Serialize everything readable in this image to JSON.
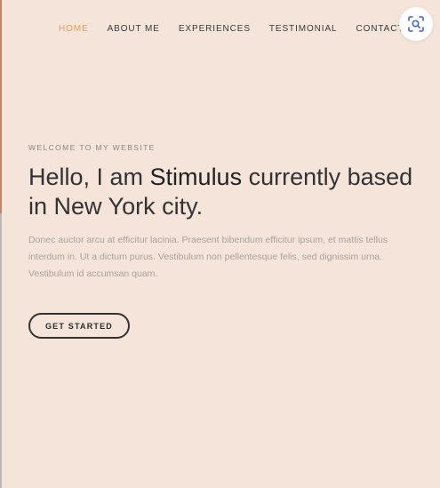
{
  "nav": {
    "items": [
      {
        "label": "HOME",
        "active": true
      },
      {
        "label": "ABOUT ME",
        "active": false
      },
      {
        "label": "EXPERIENCES",
        "active": false
      },
      {
        "label": "TESTIMONIAL",
        "active": false
      },
      {
        "label": "CONTACT",
        "active": false
      }
    ]
  },
  "hero": {
    "welcome": "WELCOME TO MY WEBSITE",
    "headline_prefix": "Hello, I am ",
    "headline_name": "Stimulus",
    "headline_suffix": " currently based in New York city.",
    "description": "Donec auctor arcu at efficitur lacinia. Praesent bibendum efficitur ipsum, et mattis tellus interdum in. Ut a dictum purus. Vestibulum non pellentesque felis, sed dignissim urna. Vestibulum id accumsan quam.",
    "cta_label": "GET STARTED"
  },
  "colors": {
    "background": "#f5e4da",
    "accent": "#e3a24f",
    "text": "#333333",
    "muted": "#a9a19b"
  },
  "icons": {
    "scan": "scan-search-icon"
  }
}
